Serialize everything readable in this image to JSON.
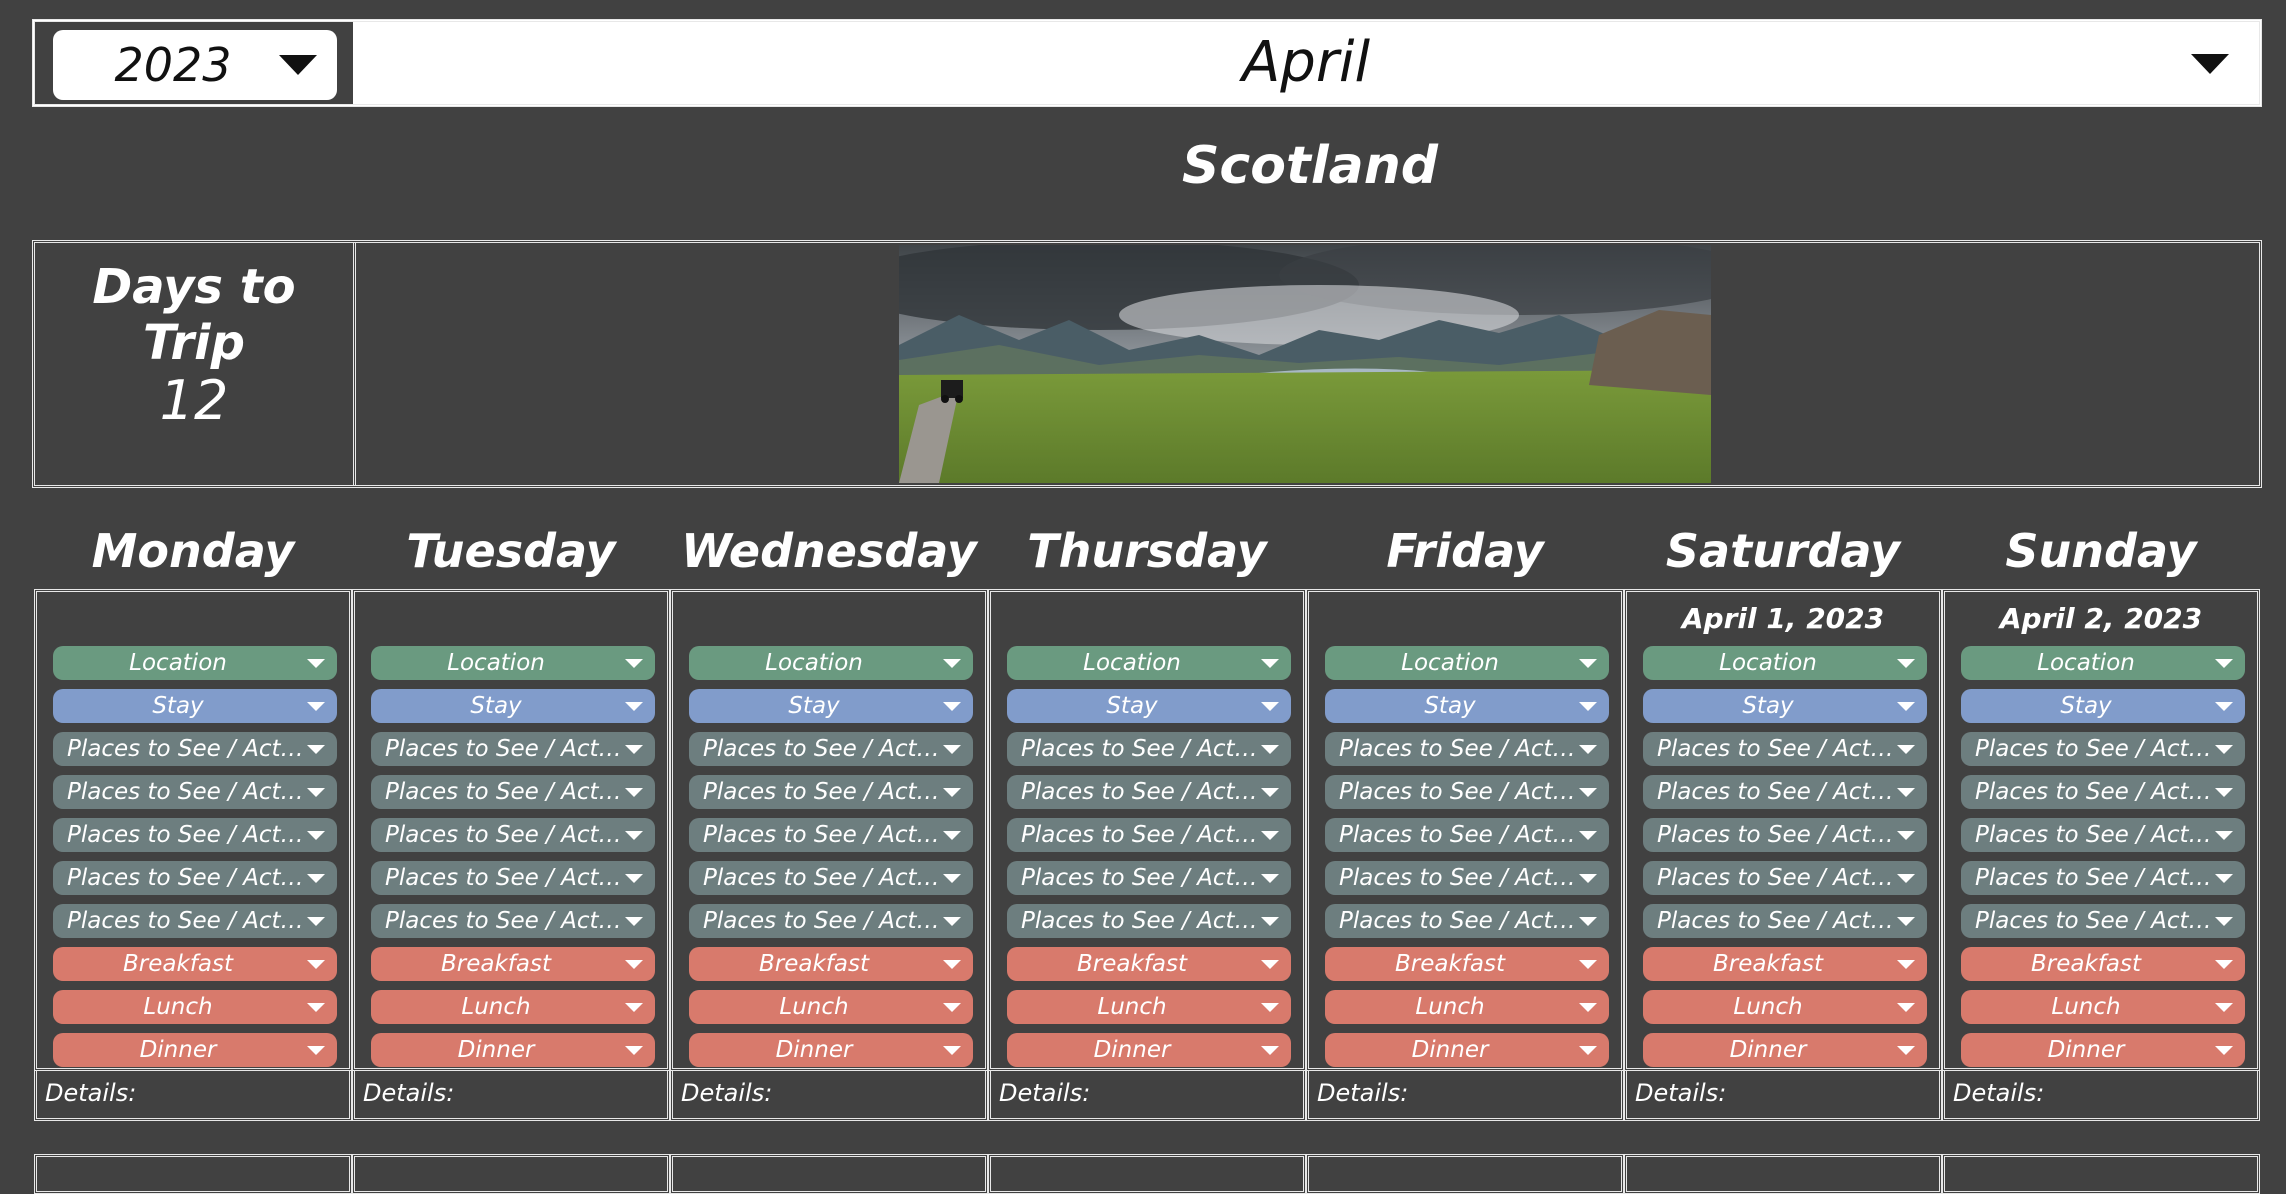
{
  "header": {
    "year": "2023",
    "month": "April"
  },
  "trip_title": "Scotland",
  "countdown": {
    "label": "Days to Trip",
    "value": "12"
  },
  "photo": {
    "description": "scenic-landscape"
  },
  "colors": {
    "background": "#414141",
    "location": "#6a9a80",
    "stay": "#819ccb",
    "places": "#6d7e7f",
    "meals": "#d87a6c"
  },
  "labels": {
    "location": "Location",
    "stay": "Stay",
    "places": "Places to See / Activi...",
    "breakfast": "Breakfast",
    "lunch": "Lunch",
    "dinner": "Dinner",
    "details": "Details:"
  },
  "days": [
    {
      "name": "Monday",
      "date": ""
    },
    {
      "name": "Tuesday",
      "date": ""
    },
    {
      "name": "Wednesday",
      "date": ""
    },
    {
      "name": "Thursday",
      "date": ""
    },
    {
      "name": "Friday",
      "date": ""
    },
    {
      "name": "Saturday",
      "date": "April 1, 2023"
    },
    {
      "name": "Sunday",
      "date": "April 2, 2023"
    }
  ]
}
